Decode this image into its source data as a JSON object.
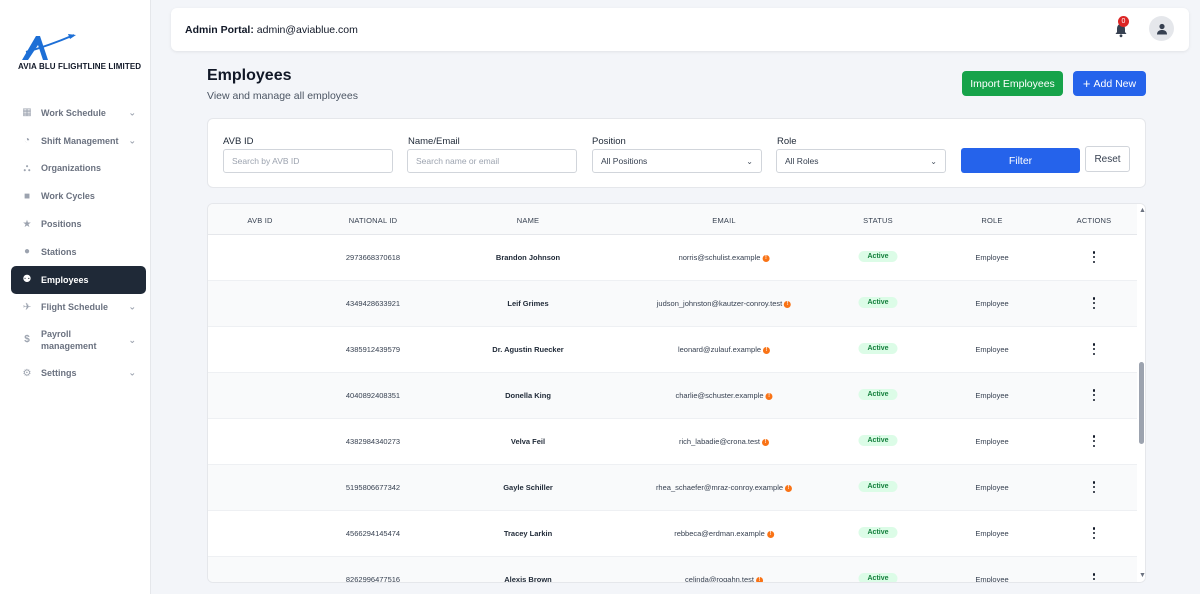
{
  "brand": {
    "name": "AVIA BLU FLIGHTLINE LIMITED"
  },
  "sidebar": {
    "items": [
      {
        "label": "Work Schedule",
        "icon": "calendar-icon",
        "chevron": true
      },
      {
        "label": "Shift Management",
        "icon": "clock-icon",
        "chevron": true
      },
      {
        "label": "Organizations",
        "icon": "building-users-icon",
        "chevron": false
      },
      {
        "label": "Work Cycles",
        "icon": "briefcase-icon",
        "chevron": false
      },
      {
        "label": "Positions",
        "icon": "star-icon",
        "chevron": false
      },
      {
        "label": "Stations",
        "icon": "map-pin-icon",
        "chevron": false
      },
      {
        "label": "Employees",
        "icon": "users-icon",
        "chevron": false,
        "active": true
      },
      {
        "label": "Flight Schedule",
        "icon": "plane-icon",
        "chevron": true
      },
      {
        "label": "Payroll management",
        "icon": "dollar-icon",
        "chevron": true
      },
      {
        "label": "Settings",
        "icon": "gear-icon",
        "chevron": true
      }
    ]
  },
  "topbar": {
    "title_prefix": "Admin Portal:",
    "title_email": "admin@aviablue.com",
    "notification_count": "0"
  },
  "header": {
    "title": "Employees",
    "subtitle": "View and manage all employees",
    "import_label": "Import Employees",
    "add_label": "Add New"
  },
  "filters": {
    "avb_label": "AVB ID",
    "avb_placeholder": "Search by AVB ID",
    "name_label": "Name/Email",
    "name_placeholder": "Search name or email",
    "position_label": "Position",
    "position_value": "All Positions",
    "role_label": "Role",
    "role_value": "All Roles",
    "filter_label": "Filter",
    "reset_label": "Reset"
  },
  "table": {
    "columns": [
      "AVB ID",
      "NATIONAL ID",
      "NAME",
      "EMAIL",
      "STATUS",
      "ROLE",
      "ACTIONS"
    ],
    "rows": [
      {
        "avb_id": "",
        "national_id": "2973668370618",
        "name": "Brandon Johnson",
        "email": "norris@schulist.example",
        "status": "Active",
        "role": "Employee"
      },
      {
        "avb_id": "",
        "national_id": "4349428633921",
        "name": "Leif Grimes",
        "email": "judson_johnston@kautzer-conroy.test",
        "status": "Active",
        "role": "Employee"
      },
      {
        "avb_id": "",
        "national_id": "4385912439579",
        "name": "Dr. Agustin Ruecker",
        "email": "leonard@zulauf.example",
        "status": "Active",
        "role": "Employee"
      },
      {
        "avb_id": "",
        "national_id": "4040892408351",
        "name": "Donella King",
        "email": "charlie@schuster.example",
        "status": "Active",
        "role": "Employee"
      },
      {
        "avb_id": "",
        "national_id": "4382984340273",
        "name": "Velva Feil",
        "email": "rich_labadie@crona.test",
        "status": "Active",
        "role": "Employee"
      },
      {
        "avb_id": "",
        "national_id": "5195806677342",
        "name": "Gayle Schiller",
        "email": "rhea_schaefer@mraz-conroy.example",
        "status": "Active",
        "role": "Employee"
      },
      {
        "avb_id": "",
        "national_id": "4566294145474",
        "name": "Tracey Larkin",
        "email": "rebbeca@erdman.example",
        "status": "Active",
        "role": "Employee"
      },
      {
        "avb_id": "",
        "national_id": "8262996477516",
        "name": "Alexis Brown",
        "email": "celinda@rogahn.test",
        "status": "Active",
        "role": "Employee"
      }
    ]
  },
  "colors": {
    "primary": "#2563eb",
    "success": "#16a34a",
    "sidebar_active": "#1f2937",
    "badge_bg": "#dcfce7",
    "badge_text": "#15803d",
    "warning": "#f97316",
    "notification": "#dc2626"
  }
}
